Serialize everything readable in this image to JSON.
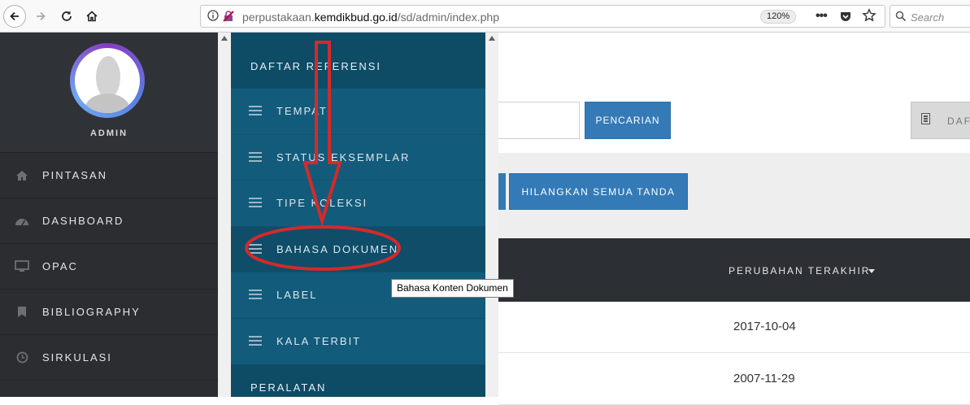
{
  "browser": {
    "url_prefix": "perpustakaan.",
    "url_domain": "kemdikbud.go.id",
    "url_path": "/sd/admin/index.php",
    "zoom": "120%",
    "search_placeholder": "Search"
  },
  "sidebar": {
    "profile_name": "ADMIN",
    "items": [
      {
        "label": "PINTASAN",
        "icon": "home-icon"
      },
      {
        "label": "DASHBOARD",
        "icon": "dashboard-icon"
      },
      {
        "label": "OPAC",
        "icon": "monitor-icon"
      },
      {
        "label": "BIBLIOGRAPHY",
        "icon": "bookmark-icon"
      },
      {
        "label": "SIRKULASI",
        "icon": "clock-icon"
      }
    ]
  },
  "submenu": {
    "header": "DAFTAR REFERENSI",
    "items": [
      {
        "label": "TEMPAT"
      },
      {
        "label": "STATUS EKSEMPLAR"
      },
      {
        "label": "TIPE KOLEKSI"
      },
      {
        "label": "BAHASA DOKUMEN",
        "active": true
      },
      {
        "label": "LABEL"
      },
      {
        "label": "KALA TERBIT"
      }
    ],
    "footer": "PERALATAN"
  },
  "tooltip": "Bahasa Konten Dokumen",
  "main": {
    "search_button": "PENCARIAN",
    "list_button": "DAF",
    "clear_marks_button": "HILANGKAN SEMUA TANDA",
    "table_header_last_change": "PERUBAHAN TERAKHIR",
    "rows": [
      {
        "date": "2017-10-04"
      },
      {
        "date": "2007-11-29"
      }
    ]
  },
  "colors": {
    "sidebar_bg": "#2b2d31",
    "submenu_bg": "#135b7a",
    "primary_button": "#337ab7",
    "annotation_red": "#d42a2a"
  }
}
